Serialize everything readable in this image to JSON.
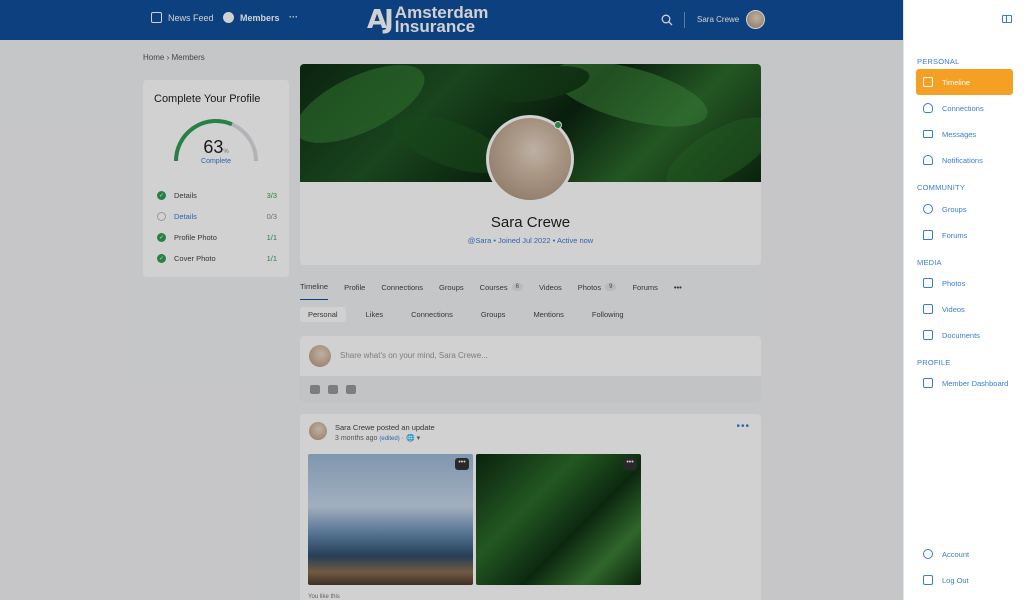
{
  "topbar": {
    "news_feed": "News Feed",
    "members": "Members",
    "more": "···",
    "logo_mark": "AJ",
    "logo_line1": "Amsterdam",
    "logo_line2": "Insurance",
    "user_name": "Sara Crewe"
  },
  "breadcrumb": "Home › Members",
  "profile_complete": {
    "title": "Complete Your Profile",
    "percent": 63,
    "percent_sign": "%",
    "label": "Complete",
    "steps": [
      {
        "label": "Details",
        "count": "3/3",
        "done": true
      },
      {
        "label": "Details",
        "count": "0/3",
        "done": false
      },
      {
        "label": "Profile Photo",
        "count": "1/1",
        "done": true
      },
      {
        "label": "Cover Photo",
        "count": "1/1",
        "done": true
      }
    ]
  },
  "profile": {
    "name": "Sara Crewe",
    "meta": "@Sara • Joined Jul 2022 • Active now"
  },
  "tabs": [
    {
      "label": "Timeline",
      "active": true
    },
    {
      "label": "Profile"
    },
    {
      "label": "Connections"
    },
    {
      "label": "Groups"
    },
    {
      "label": "Courses",
      "badge": "6"
    },
    {
      "label": "Videos"
    },
    {
      "label": "Photos",
      "badge": "9"
    },
    {
      "label": "Forums"
    },
    {
      "label": "•••"
    }
  ],
  "subtabs": [
    "Personal",
    "Likes",
    "Connections",
    "Groups",
    "Mentions",
    "Following"
  ],
  "composer": {
    "placeholder": "Share what's on your mind, Sara Crewe..."
  },
  "post": {
    "author_line": "Sara Crewe posted an update",
    "time": "3 months ago",
    "edited": "(edited)",
    "more": "•••",
    "you_like": "You like this",
    "photo_more": "•••"
  },
  "panel": {
    "sections": {
      "personal": "PERSONAL",
      "community": "COMMUNITY",
      "media": "MEDIA",
      "profile": "PROFILE"
    },
    "items": {
      "timeline": "Timeline",
      "connections": "Connections",
      "messages": "Messages",
      "notifications": "Notifications",
      "groups": "Groups",
      "forums": "Forums",
      "photos": "Photos",
      "videos": "Videos",
      "documents": "Documents",
      "member_dashboard": "Member Dashboard",
      "account": "Account",
      "logout": "Log Out"
    }
  },
  "colors": {
    "topbar": "#0f4f9c",
    "accent": "#f4a024",
    "link": "#3a7bd5",
    "success": "#2e9e55"
  }
}
